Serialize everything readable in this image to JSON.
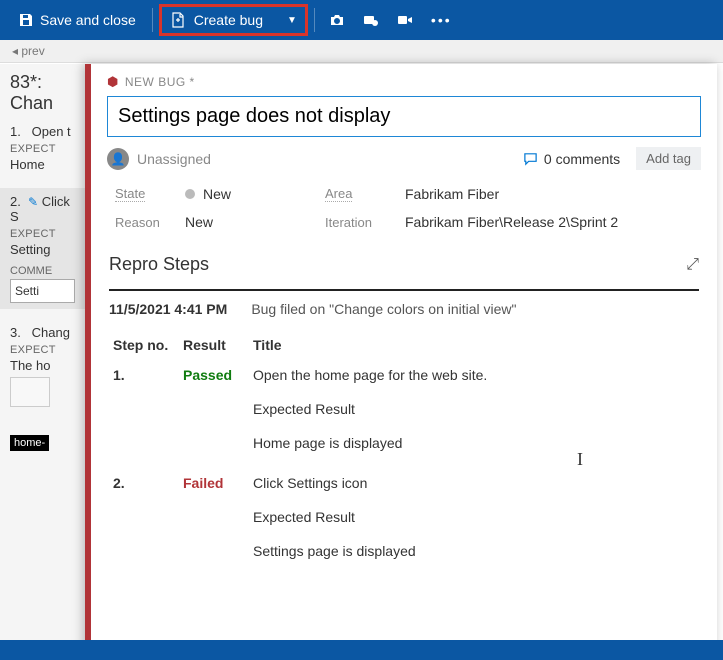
{
  "toolbar": {
    "save_close": "Save and close",
    "create_bug": "Create bug"
  },
  "nav": {
    "prev": "prev"
  },
  "left": {
    "title": "83*: Chan",
    "steps": [
      {
        "no": "1.",
        "title": "Open t",
        "expected_label": "EXPECT",
        "expected": "Home"
      },
      {
        "no": "2.",
        "title": "Click S",
        "expected_label": "EXPECT",
        "expected": "Setting",
        "comm_label": "COMME",
        "comm_value": "Setti"
      },
      {
        "no": "3.",
        "title": "Chang",
        "expected_label": "EXPECT",
        "expected": "The ho"
      }
    ],
    "black_tag": "home-"
  },
  "bug": {
    "type_label": "NEW BUG *",
    "title": "Settings page does not display",
    "assignee": "Unassigned",
    "comments_count": "0 comments",
    "add_tag": "Add tag",
    "state_label": "State",
    "state_value": "New",
    "reason_label": "Reason",
    "reason_value": "New",
    "area_label": "Area",
    "area_value": "Fabrikam Fiber",
    "iteration_label": "Iteration",
    "iteration_value": "Fabrikam Fiber\\Release 2\\Sprint 2"
  },
  "repro": {
    "heading": "Repro Steps",
    "timestamp": "11/5/2021 4:41 PM",
    "filed_on": "Bug filed on \"Change colors on initial view\"",
    "columns": {
      "stepno": "Step no.",
      "result": "Result",
      "title": "Title"
    },
    "rows": [
      {
        "no": "1.",
        "result": "Passed",
        "result_class": "passed",
        "lines": [
          "Open the home page for the web site.",
          "Expected Result",
          "Home page is displayed"
        ]
      },
      {
        "no": "2.",
        "result": "Failed",
        "result_class": "failed",
        "lines": [
          "Click Settings icon",
          "Expected Result",
          "Settings page is displayed"
        ]
      }
    ]
  }
}
